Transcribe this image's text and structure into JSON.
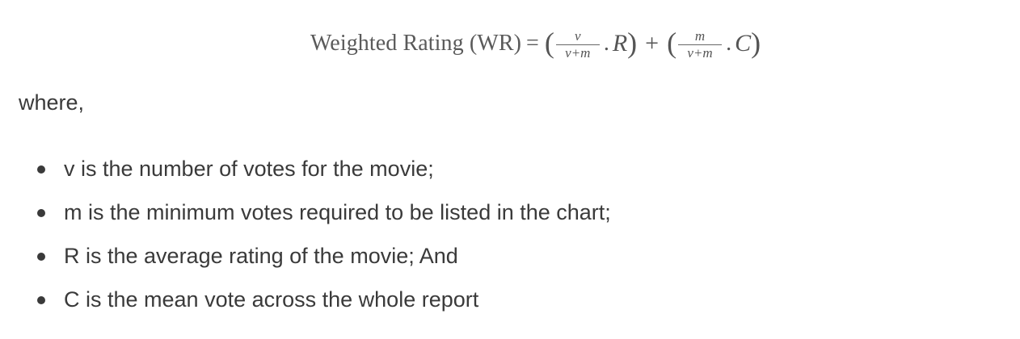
{
  "formula": {
    "label": "Weighted Rating (WR)",
    "equals": "=",
    "open_paren": "(",
    "close_paren": ")",
    "frac1": {
      "numerator": "v",
      "denominator": "v+m"
    },
    "frac2": {
      "numerator": "m",
      "denominator": "v+m"
    },
    "dot": ".",
    "var_r": "R",
    "var_c": "C",
    "plus": "+"
  },
  "intro": "where,",
  "items": [
    {
      "text": "v is the number of votes for the movie;"
    },
    {
      "text": "m is the minimum votes required to be listed in the chart;"
    },
    {
      "text": "R is the average rating of the movie; And"
    },
    {
      "text": "C is the mean vote across the whole report"
    }
  ]
}
